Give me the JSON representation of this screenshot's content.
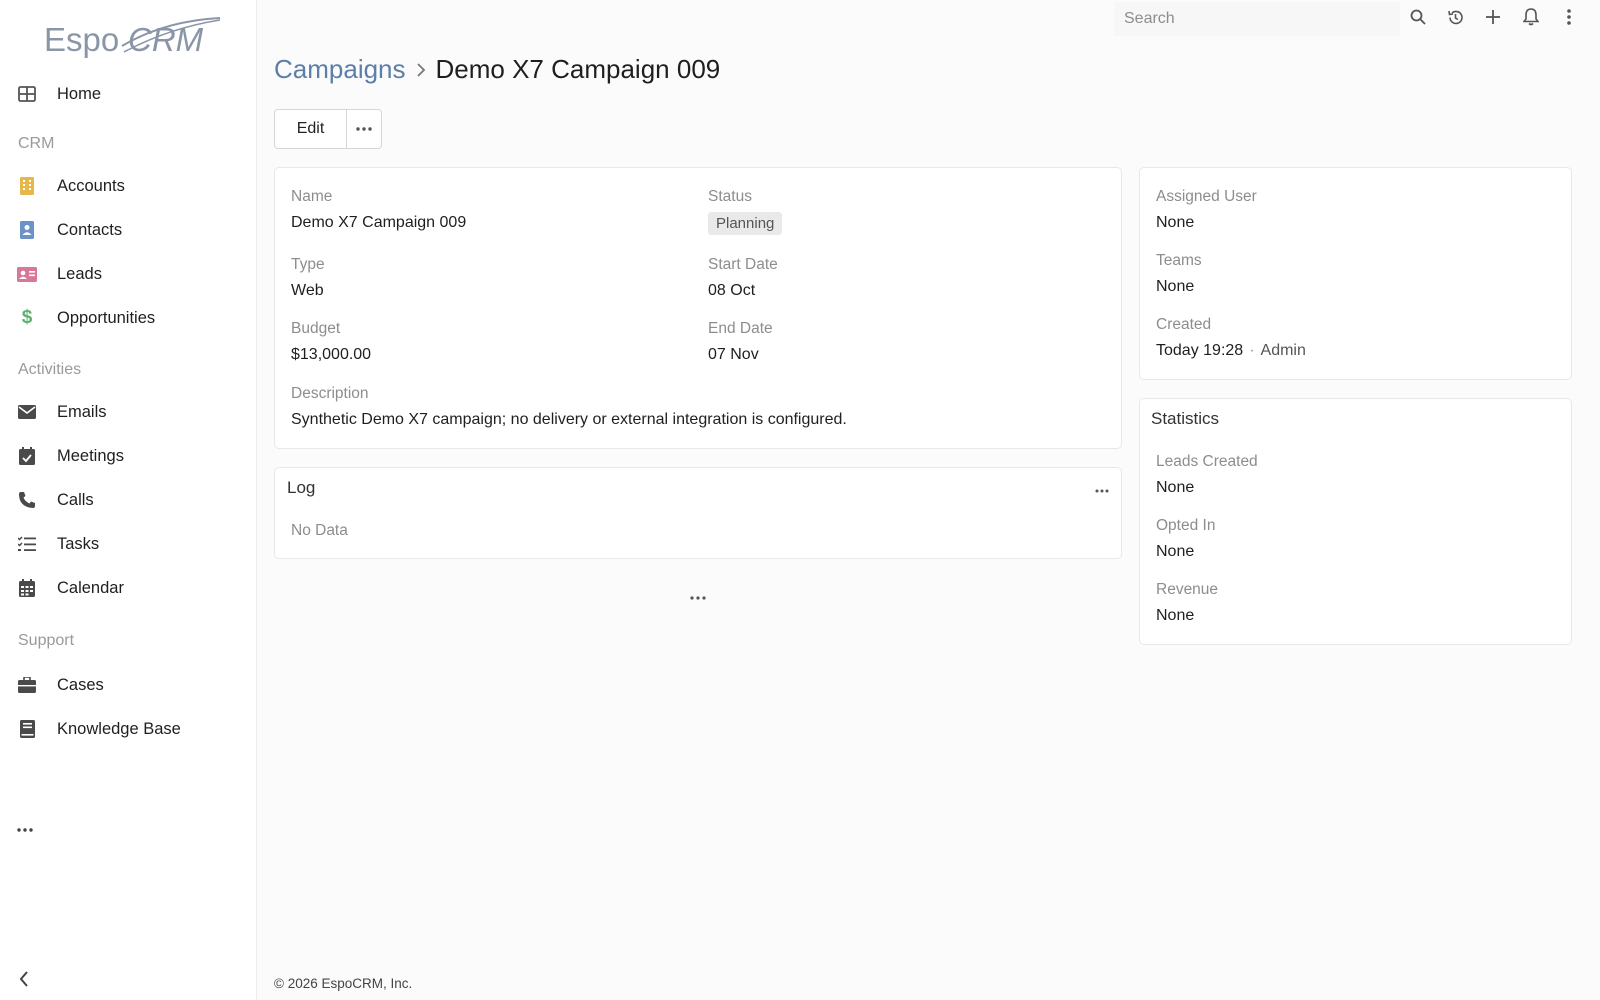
{
  "logo": {
    "text": "EspoCRM"
  },
  "sidebar": {
    "items": [
      {
        "label": "Home",
        "icon": "grid-icon",
        "color": "#5a5a5a"
      },
      {
        "group": "CRM"
      },
      {
        "label": "Accounts",
        "icon": "building-icon",
        "color": "#e6b84a"
      },
      {
        "label": "Contacts",
        "icon": "contact-card-icon",
        "color": "#6b93c9"
      },
      {
        "label": "Leads",
        "icon": "id-card-icon",
        "color": "#d9779a"
      },
      {
        "label": "Opportunities",
        "icon": "dollar-icon",
        "color": "#5ab26b"
      },
      {
        "group": "Activities"
      },
      {
        "label": "Emails",
        "icon": "envelope-icon",
        "color": "#4a4a4a"
      },
      {
        "label": "Meetings",
        "icon": "calendar-check-icon",
        "color": "#4a4a4a"
      },
      {
        "label": "Calls",
        "icon": "phone-icon",
        "color": "#4a4a4a"
      },
      {
        "label": "Tasks",
        "icon": "list-check-icon",
        "color": "#4a4a4a"
      },
      {
        "label": "Calendar",
        "icon": "calendar-icon",
        "color": "#4a4a4a"
      },
      {
        "group": "Support"
      },
      {
        "label": "Cases",
        "icon": "briefcase-icon",
        "color": "#4a4a4a"
      },
      {
        "label": "Knowledge Base",
        "icon": "book-icon",
        "color": "#4a4a4a"
      }
    ]
  },
  "topbar": {
    "search_placeholder": "Search"
  },
  "header": {
    "breadcrumb_parent": "Campaigns",
    "title": "Demo X7 Campaign 009",
    "edit_label": "Edit"
  },
  "details": {
    "name_label": "Name",
    "name_value": "Demo X7 Campaign 009",
    "status_label": "Status",
    "status_value": "Planning",
    "type_label": "Type",
    "type_value": "Web",
    "start_label": "Start Date",
    "start_value": "08 Oct",
    "budget_label": "Budget",
    "budget_value": "$13,000.00",
    "end_label": "End Date",
    "end_value": "07 Nov",
    "description_label": "Description",
    "description_value": "Synthetic Demo X7 campaign; no delivery or external integration is configured."
  },
  "log": {
    "title": "Log",
    "empty": "No Data"
  },
  "side": {
    "assigned_label": "Assigned User",
    "assigned_value": "None",
    "teams_label": "Teams",
    "teams_value": "None",
    "created_label": "Created",
    "created_value": "Today 19:28",
    "created_by": "Admin"
  },
  "statistics": {
    "title": "Statistics",
    "leads_label": "Leads Created",
    "leads_value": "None",
    "opted_label": "Opted In",
    "opted_value": "None",
    "revenue_label": "Revenue",
    "revenue_value": "None"
  },
  "footer": {
    "text": "© 2026 EspoCRM, Inc."
  }
}
